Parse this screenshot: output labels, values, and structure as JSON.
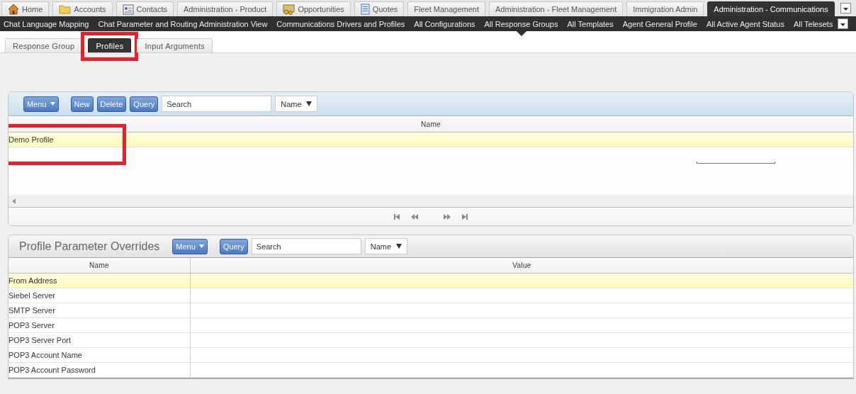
{
  "screen_tabs": [
    {
      "label": "Home",
      "selected": false
    },
    {
      "label": "Accounts",
      "selected": false
    },
    {
      "label": "Contacts",
      "selected": false
    },
    {
      "label": "Administration - Product",
      "selected": false
    },
    {
      "label": "Opportunities",
      "selected": false
    },
    {
      "label": "Quotes",
      "selected": false
    },
    {
      "label": "Fleet Management",
      "selected": false
    },
    {
      "label": "Administration - Fleet Management",
      "selected": false
    },
    {
      "label": "Immigration Admin",
      "selected": false
    },
    {
      "label": "Administration - Communications",
      "selected": true
    }
  ],
  "view_links": [
    {
      "label": "Chat Language Mapping",
      "selected": false
    },
    {
      "label": "Chat Parameter and Routing Administration View",
      "selected": false
    },
    {
      "label": "Communications Drivers and Profiles",
      "selected": false
    },
    {
      "label": "All Configurations",
      "selected": false
    },
    {
      "label": "All Response Groups",
      "selected": true
    },
    {
      "label": "All Templates",
      "selected": false
    },
    {
      "label": "Agent General Profile",
      "selected": false
    },
    {
      "label": "All Active Agent Status",
      "selected": false
    },
    {
      "label": "All Telesets",
      "selected": false
    }
  ],
  "sub_tabs": [
    {
      "label": "Response Group",
      "selected": false,
      "highlighted": false
    },
    {
      "label": "Profiles",
      "selected": true,
      "highlighted": true
    },
    {
      "label": "Input Arguments",
      "selected": false,
      "highlighted": false
    }
  ],
  "profiles_applet": {
    "menu": "Menu",
    "buttons": [
      "New",
      "Delete",
      "Query"
    ],
    "search": {
      "placeholder": "Search"
    },
    "search_by": "Name",
    "columns": [
      "Name"
    ],
    "rows": [
      {
        "name": "Demo Profile",
        "selected": true,
        "highlighted": true
      }
    ]
  },
  "overrides_applet": {
    "title": "Profile Parameter Overrides",
    "menu": "Menu",
    "buttons": [
      "Query"
    ],
    "search": {
      "placeholder": "Search"
    },
    "search_by": "Name",
    "columns": [
      "Name",
      "Value"
    ],
    "rows": [
      {
        "name": "From Address",
        "selected": true
      },
      {
        "name": "Siebel Server",
        "selected": false
      },
      {
        "name": "SMTP Server",
        "selected": false
      },
      {
        "name": "POP3 Server",
        "selected": false
      },
      {
        "name": "POP3 Server Port",
        "selected": false
      },
      {
        "name": "POP3 Account Name",
        "selected": false
      },
      {
        "name": "POP3 Account Password",
        "selected": false
      }
    ]
  }
}
